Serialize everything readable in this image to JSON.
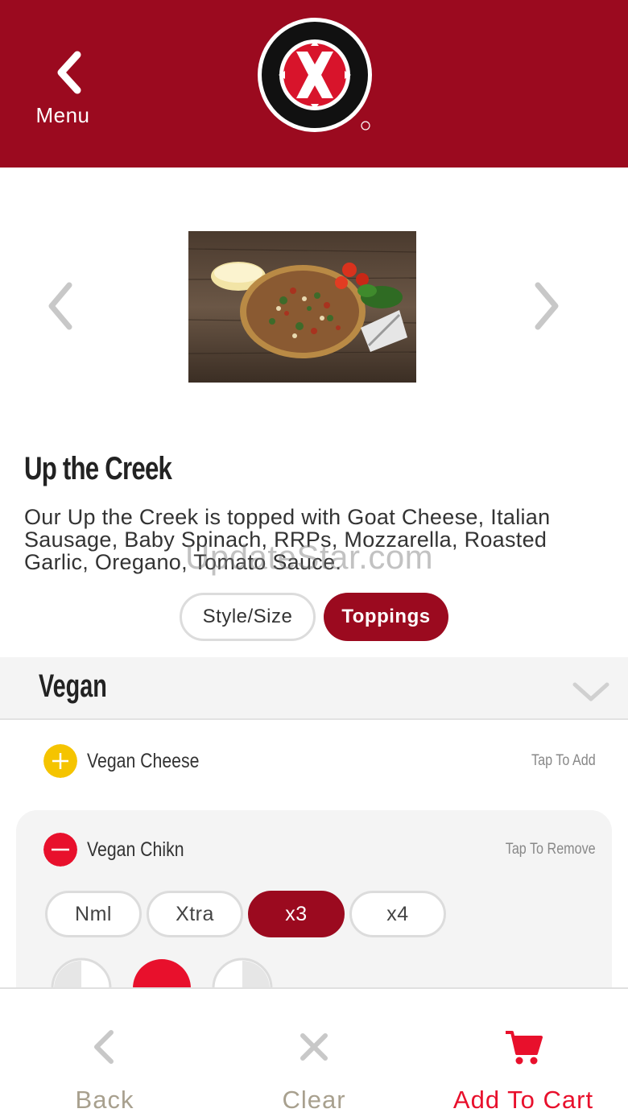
{
  "header": {
    "back_label": "Menu",
    "brand_name": "Extreme Pizza",
    "background_color": "#9b0a1f"
  },
  "product": {
    "title": "Up the Creek",
    "description": "Our Up the Creek is topped with Goat Cheese, Italian Sausage, Baby Spinach, RRPs, Mozzarella, Roasted Garlic, Oregano, Tomato Sauce.",
    "image_alt": "Up the Creek pizza"
  },
  "watermark": "UpdateStar.com",
  "tabs": {
    "style_size": "Style/Size",
    "toppings": "Toppings",
    "active": "Toppings"
  },
  "section": {
    "name": "Vegan",
    "expanded": true
  },
  "toppings": [
    {
      "name": "Vegan Cheese",
      "hint": "Tap To Add",
      "selected": false,
      "icon": "plus-icon",
      "icon_color": "#f5c400"
    },
    {
      "name": "Vegan Chikn",
      "hint": "Tap To Remove",
      "selected": true,
      "icon": "minus-icon",
      "icon_color": "#e8102c"
    }
  ],
  "quantity_options": [
    {
      "label": "Nml",
      "active": false
    },
    {
      "label": "Xtra",
      "active": false
    },
    {
      "label": "x3",
      "active": true
    },
    {
      "label": "x4",
      "active": false
    }
  ],
  "bottom_bar": {
    "back_label": "Back",
    "clear_label": "Clear",
    "add_to_cart_label": "Add To Cart",
    "accent_color": "#e8102c",
    "muted_color": "#a8a08e"
  }
}
